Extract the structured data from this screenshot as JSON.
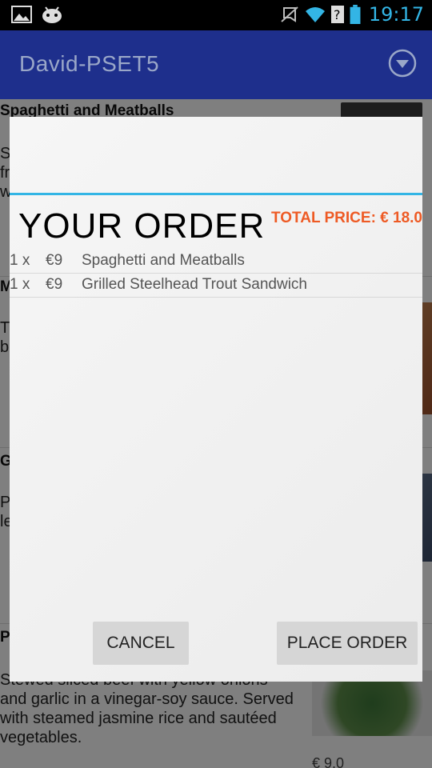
{
  "status_bar": {
    "time": "19:17",
    "icons": [
      "gallery-icon",
      "android-icon",
      "mute-icon",
      "wifi-icon",
      "no-sim-icon",
      "battery-icon"
    ]
  },
  "action_bar": {
    "title": "David-PSET5",
    "overflow_icon": "dropdown-circle-icon",
    "background": "#1e2f8c"
  },
  "background_menu": {
    "items": [
      {
        "title": "Spaghetti and Meatballs",
        "desc_fragment": "S\nfr\nw"
      },
      {
        "title": "M",
        "desc_fragment": "T\nb"
      },
      {
        "title": "G",
        "desc_fragment": "P\nle"
      },
      {
        "title": "P",
        "desc_fragment": "Stewed sliced beef with yellow onions and garlic in a vinegar-soy sauce. Served with steamed jasmine rice and sautéed vegetables.",
        "price_fragment": "€ 9.0"
      }
    ]
  },
  "dialog": {
    "heading": "YOUR ORDER",
    "total_price": "TOTAL PRICE: € 18.0",
    "accent": "#33b5e5",
    "price_color": "#ee5a24",
    "order_items": [
      {
        "qty": "1 x",
        "price": "€9",
        "name": "Spaghetti and Meatballs"
      },
      {
        "qty": "1 x",
        "price": "€9",
        "name": "Grilled Steelhead Trout Sandwich"
      }
    ],
    "cancel_label": "CANCEL",
    "place_order_label": "PLACE ORDER"
  }
}
